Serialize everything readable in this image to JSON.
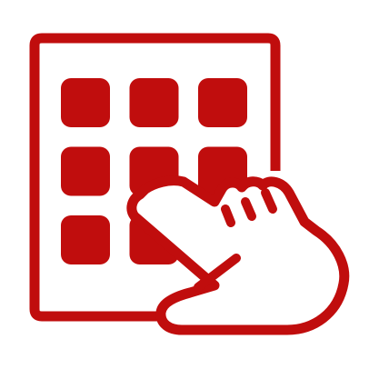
{
  "icon": {
    "name": "touch-keypad-icon",
    "color": "#c00d0d",
    "background": "#ffffff"
  },
  "keypad": {
    "rows": 3,
    "columns": 3
  }
}
